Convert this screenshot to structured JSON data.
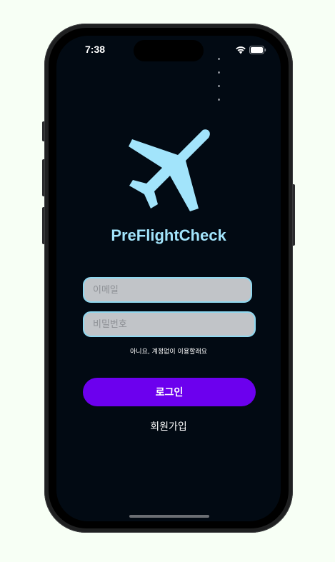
{
  "status_bar": {
    "time": "7:38",
    "icons": [
      "signal-dots-icon",
      "wifi-icon",
      "battery-icon"
    ]
  },
  "app": {
    "logo_icon": "airplane-icon",
    "title": "PreFlightCheck"
  },
  "login_form": {
    "email_placeholder": "이메일",
    "password_placeholder": "비밀번호",
    "guest_link": "아니요, 계정없이 이용할래요",
    "login_button": "로그인",
    "signup_link": "회원가입"
  },
  "colors": {
    "background": "#020a13",
    "accent": "#a2e4fb",
    "primary_button": "#6c00ee",
    "input_border": "#8fd8f0",
    "input_fill": "#c1c4c8"
  }
}
